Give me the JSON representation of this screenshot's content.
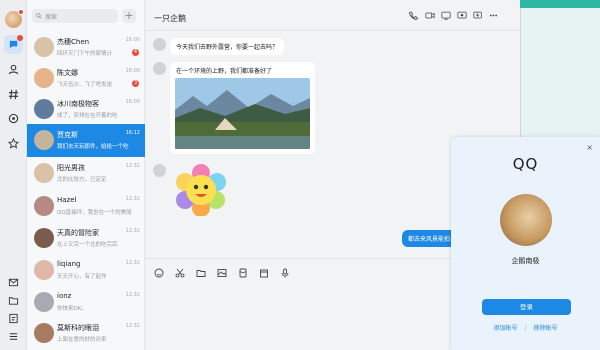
{
  "search": {
    "placeholder": "搜索"
  },
  "chat_list": [
    {
      "name": "杰穗Chen",
      "preview": "回环灭门下午的家情计",
      "time": "16:00",
      "count": "4",
      "avatar": "#d8c3a8"
    },
    {
      "name": "陈文娜",
      "preview": "飞天伍沙、飞了吧发送",
      "time": "16:00",
      "count": "3",
      "avatar": "#e6b38a"
    },
    {
      "name": "冰川南极物客",
      "preview": "成了，安排在在开着的吃",
      "time": "16:00",
      "count": "",
      "avatar": "#5f7c9c"
    },
    {
      "name": "贾克斯",
      "preview": "我们去天玩那件，给给一个吃",
      "time": "16:12",
      "count": "",
      "avatar": "#c4b49c"
    },
    {
      "name": "阳光男孩",
      "preview": "北的比较方，已定定",
      "time": "12:32",
      "count": "",
      "avatar": "#d9c2a8"
    },
    {
      "name": "Hazel",
      "preview": "QQ直接坪，我坐在一个的美丽",
      "time": "12:32",
      "count": "",
      "avatar": "#b48a82"
    },
    {
      "name": "天真的冒险家",
      "preview": "在上又完一个北的吃完后",
      "time": "12:32",
      "count": "",
      "avatar": "#7b5b4c"
    },
    {
      "name": "liqiang",
      "preview": "天天开心，有了起作",
      "time": "12:32",
      "count": "",
      "avatar": "#e0b8a8"
    },
    {
      "name": "ionz",
      "preview": "你快来OK。",
      "time": "12:32",
      "count": "",
      "avatar": "#a9a9b4"
    },
    {
      "name": "莫斯科的眼泪",
      "preview": "上面在意的好的对来",
      "time": "12:32",
      "count": "",
      "avatar": "#a77a62"
    }
  ],
  "chat": {
    "title": "一只企鹅",
    "messages": [
      {
        "text": "今天我们去野外露营，你要一起去吗？"
      },
      {
        "text": "在一个环境的上野，我们都准备好了"
      }
    ],
    "my_message": "都去来风景能拍"
  },
  "login": {
    "brand": "QQ",
    "username": "企鹅南极",
    "login_button": "登录",
    "add_account": "添加帐号",
    "remove_account": "移除帐号",
    "close": "×"
  }
}
